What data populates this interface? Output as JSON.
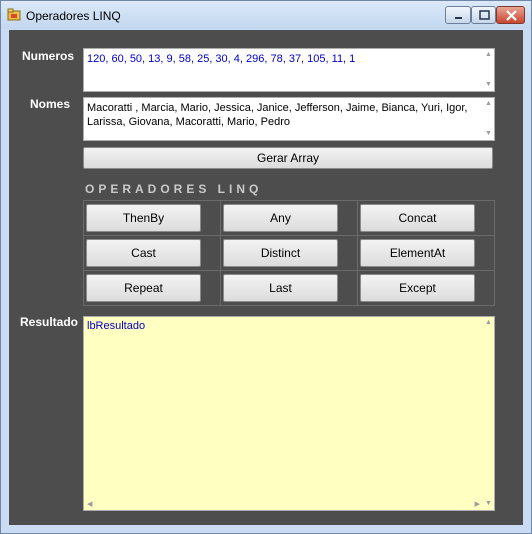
{
  "window": {
    "title": "Operadores LINQ"
  },
  "labels": {
    "numeros": "Numeros",
    "nomes": "Nomes",
    "resultado": "Resultado"
  },
  "inputs": {
    "numeros": "120, 60, 50, 13, 9, 58, 25, 30, 4, 296, 78, 37, 105, 11, 1",
    "nomes": "Macoratti , Marcia, Mario, Jessica, Janice, Jefferson, Jaime, Bianca, Yuri, Igor, Larissa, Giovana, Macoratti, Mario, Pedro"
  },
  "gerar_button": "Gerar Array",
  "section_title": "OPERADORES LINQ",
  "operators": [
    "ThenBy",
    "Any",
    "Concat",
    "Cast",
    "Distinct",
    "ElementAt",
    "Repeat",
    "Last",
    "Except"
  ],
  "result": {
    "text": "lbResultado"
  },
  "colors": {
    "numeros_text": "#0000c8",
    "result_bg": "#ffffc2",
    "client_bg": "#4d4d4d"
  },
  "icons": {
    "app": "app-icon",
    "minimize": "minimize-icon",
    "maximize": "maximize-icon",
    "close": "close-icon"
  }
}
